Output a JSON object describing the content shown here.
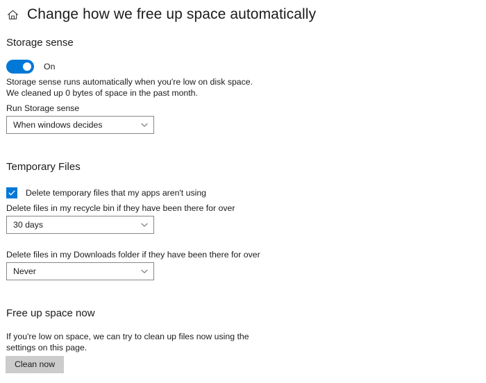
{
  "header": {
    "home_icon": "home-icon",
    "title": "Change how we free up space automatically"
  },
  "storage_sense": {
    "heading": "Storage sense",
    "toggle": {
      "state_label": "On",
      "is_on": true,
      "accent_color": "#0078d7"
    },
    "description_line1": "Storage sense runs automatically when you're low on disk space.",
    "description_line2": "We cleaned up 0 bytes of space in the past month.",
    "run_label": "Run Storage sense",
    "run_dropdown": {
      "value": "When windows decides",
      "chevron_icon": "chevron-down-icon"
    }
  },
  "temporary_files": {
    "heading": "Temporary Files",
    "checkbox": {
      "label": "Delete temporary files that my apps aren't using",
      "checked": true,
      "accent_color": "#0078d7",
      "check_icon": "check-icon"
    },
    "recycle_bin_label": "Delete files in my recycle bin if they have been there for over",
    "recycle_bin_dropdown": {
      "value": "30 days",
      "chevron_icon": "chevron-down-icon"
    },
    "downloads_label": "Delete files in my Downloads folder if they have been there for over",
    "downloads_dropdown": {
      "value": "Never",
      "chevron_icon": "chevron-down-icon"
    }
  },
  "free_up_space": {
    "heading": "Free up space now",
    "description_line1": "If you're low on space, we can try to clean up files now using the",
    "description_line2": "settings on this page.",
    "clean_button_label": "Clean now"
  }
}
